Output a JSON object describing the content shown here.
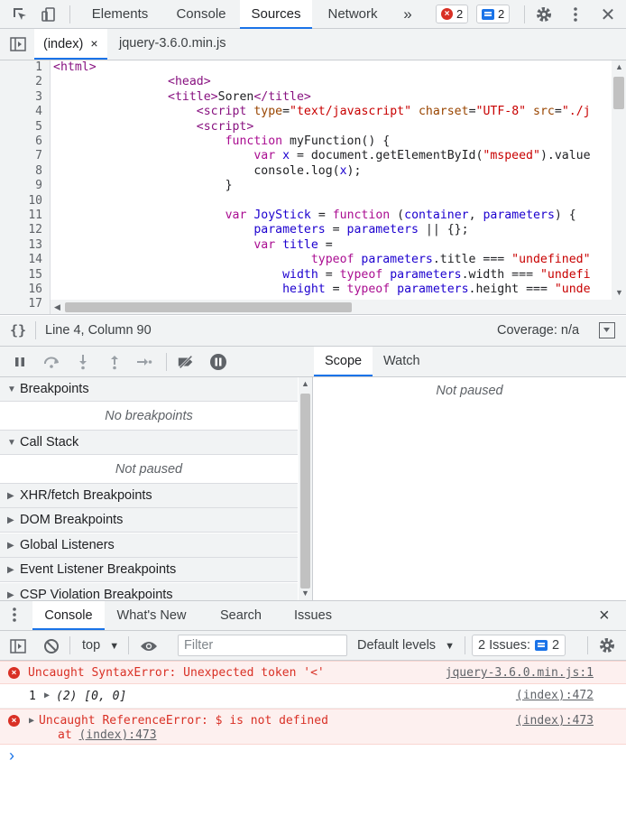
{
  "main_toolbar": {
    "tabs": [
      "Elements",
      "Console",
      "Sources",
      "Network"
    ],
    "active_tab": "Sources",
    "more_tabs": "»",
    "error_count": "2",
    "message_count": "2"
  },
  "file_tabs": [
    {
      "label": "(index)",
      "active": true,
      "close": "×"
    },
    {
      "label": "jquery-3.6.0.min.js",
      "active": false
    }
  ],
  "editor": {
    "line_numbers": [
      "1",
      "2",
      "3",
      "4",
      "5",
      "6",
      "7",
      "8",
      "9",
      "10",
      "11",
      "12",
      "13",
      "14",
      "15",
      "16",
      "17"
    ]
  },
  "status_bar": {
    "braces": "{}",
    "position": "Line 4, Column 90",
    "coverage": "Coverage: n/a"
  },
  "debugger": {
    "scope_tabs": [
      "Scope",
      "Watch"
    ],
    "scope_status": "Not paused",
    "panes": [
      {
        "title": "Breakpoints",
        "expanded": true,
        "body": "No breakpoints"
      },
      {
        "title": "Call Stack",
        "expanded": true,
        "body": "Not paused"
      },
      {
        "title": "XHR/fetch Breakpoints",
        "expanded": false
      },
      {
        "title": "DOM Breakpoints",
        "expanded": false
      },
      {
        "title": "Global Listeners",
        "expanded": false
      },
      {
        "title": "Event Listener Breakpoints",
        "expanded": false
      },
      {
        "title": "CSP Violation Breakpoints",
        "expanded": false
      }
    ]
  },
  "drawer": {
    "tabs": [
      "Console",
      "What's New",
      "Search",
      "Issues"
    ],
    "active_tab": "Console",
    "close": "×"
  },
  "console_toolbar": {
    "context": "top",
    "filter_placeholder": "Filter",
    "levels": "Default levels",
    "issues_label": "2 Issues:",
    "issues_count": "2"
  },
  "console_messages": [
    {
      "type": "error",
      "text": "Uncaught SyntaxError: Unexpected token '<'",
      "source": "jquery-3.6.0.min.js:1"
    },
    {
      "type": "log",
      "count": "1",
      "text": "(2) [0, 0]",
      "source": "(index):472"
    },
    {
      "type": "error",
      "text": "Uncaught ReferenceError: $ is not defined",
      "source": "(index):473",
      "stack_prefix": "at",
      "stack_link": "(index):473"
    }
  ],
  "console_prompt": "›"
}
